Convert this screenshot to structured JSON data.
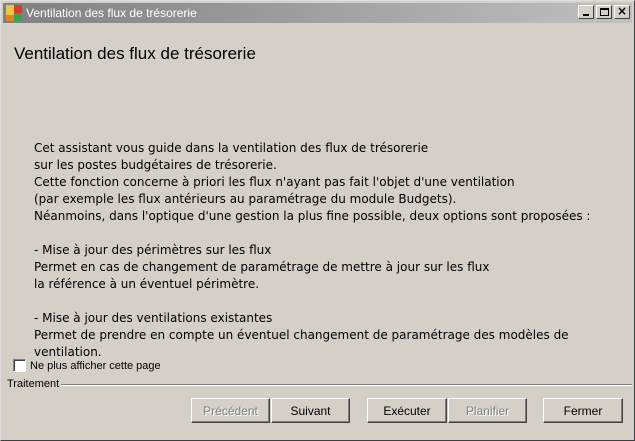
{
  "window": {
    "title": "Ventilation des flux de trésorerie",
    "icon": "app-icon",
    "controls": [
      "minimize-icon",
      "maximize-icon",
      "close-icon"
    ],
    "close_glyph": "×"
  },
  "page": {
    "heading": "Ventilation des flux de trésorerie",
    "lines": [
      "Cet assistant vous guide dans la ventilation des flux de trésorerie",
      "sur les postes budgétaires de trésorerie.",
      "Cette fonction concerne à priori les flux n'ayant pas fait l'objet d'une ventilation",
      "(par exemple les flux antérieurs au paramétrage du module Budgets).",
      "Néanmoins, dans l'optique d'une gestion la plus fine possible, deux options sont proposées :",
      "",
      "- Mise à jour des périmètres sur les flux",
      "Permet en cas de changement de paramétrage de mettre à jour sur les flux",
      "la référence à un éventuel périmètre.",
      "",
      "- Mise à jour des ventilations existantes",
      "Permet de prendre en compte un éventuel changement de paramétrage des modèles de",
      "ventilation."
    ]
  },
  "options": {
    "dont_show_label": "Ne plus afficher cette page",
    "dont_show_checked": false
  },
  "footer": {
    "group_label": "Traitement",
    "buttons": {
      "previous": "Précédent",
      "next": "Suivant",
      "execute": "Exécuter",
      "schedule": "Planifier",
      "close": "Fermer"
    }
  }
}
